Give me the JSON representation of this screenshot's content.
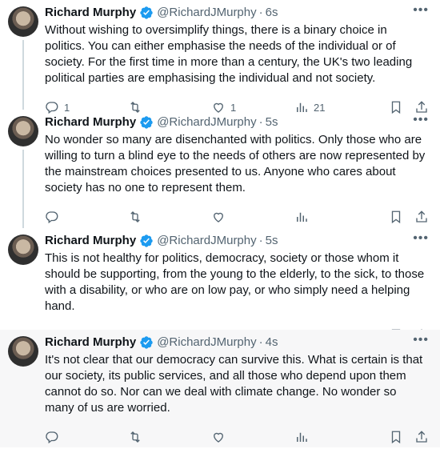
{
  "tweets": [
    {
      "name": "Richard Murphy",
      "handle": "@RichardJMurphy",
      "time": "6s",
      "text": "Without wishing to oversimplify things, there is a binary choice in politics. You can either emphasise the needs of the individual or of society. For the first time in more than a century, the UK's two leading political parties are emphasising the individual and not society.",
      "replies": "1",
      "retweets": "",
      "likes": "1",
      "views": "21"
    },
    {
      "name": "Richard Murphy",
      "handle": "@RichardJMurphy",
      "time": "5s",
      "text": "No wonder so many are disenchanted with politics. Only those who are willing to turn a blind eye to the needs of others are now represented by the mainstream choices presented to us. Anyone who cares about society has no one to represent them.",
      "replies": "",
      "retweets": "",
      "likes": "",
      "views": ""
    },
    {
      "name": "Richard Murphy",
      "handle": "@RichardJMurphy",
      "time": "5s",
      "text": "This is not healthy for politics, democracy, society or those whom it should be supporting, from the young to the elderly, to the sick, to those with a disability, or who are on low pay, or who simply need a helping hand.",
      "replies": "",
      "retweets": "",
      "likes": "",
      "views": ""
    },
    {
      "name": "Richard Murphy",
      "handle": "@RichardJMurphy",
      "time": "4s",
      "text": "It's not clear that our democracy can survive this. What is certain is that our society, its public services, and all those who depend upon them cannot do so.  Nor can we deal with climate change. No wonder so many of us are worried.",
      "replies": "",
      "retweets": "",
      "likes": "",
      "views": ""
    }
  ],
  "dot": "·",
  "more": "•••",
  "icons": [
    "verified-badge-icon",
    "reply-icon",
    "retweet-icon",
    "like-icon",
    "views-icon",
    "bookmark-icon",
    "share-icon"
  ],
  "colors": {
    "verified": "#1d9bf0",
    "muted": "#536471",
    "text": "#0f1419",
    "thread_line": "#cfd9de"
  }
}
